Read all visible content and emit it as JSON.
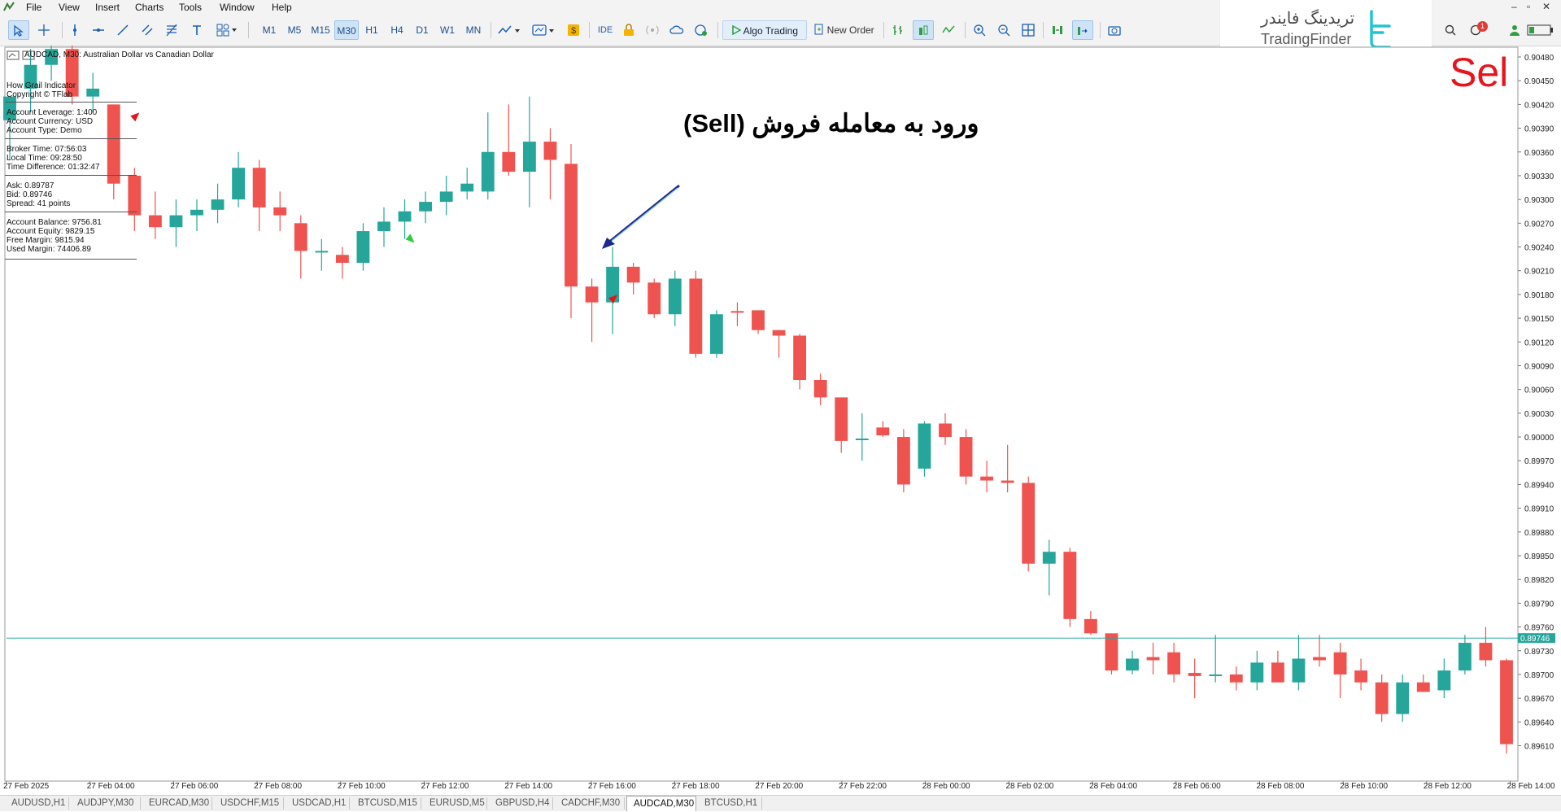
{
  "menu": [
    "File",
    "View",
    "Insert",
    "Charts",
    "Tools",
    "Window",
    "Help"
  ],
  "window_controls": [
    "–",
    "▫",
    "✕"
  ],
  "toolbar": {
    "timeframes": [
      "M1",
      "M5",
      "M15",
      "M30",
      "H1",
      "H4",
      "D1",
      "W1",
      "MN"
    ],
    "active_timeframe": "M30",
    "ide_label": "IDE",
    "algo_label": "Algo Trading",
    "new_order_label": "New Order",
    "notification_count": "1"
  },
  "watermark": {
    "fa": "تریدینگ فایندر",
    "en": "TradingFinder"
  },
  "chart_title": "AUDCAD, M30:  Australian Dollar vs Canadian Dollar",
  "info_panel": {
    "header": [
      "How Grail Indicator",
      "Copyright © TFlab"
    ],
    "account": [
      "Account Leverage: 1:400",
      "Account Currency: USD",
      "Account Type: Demo"
    ],
    "time": [
      "Broker Time: 07:56:03",
      "Local Time: 09:28:50",
      "Time Difference: 01:32:47"
    ],
    "prices": [
      "Ask: 0.89787",
      "Bid: 0.89746",
      "Spread: 41 points"
    ],
    "balance": [
      "Account Balance: 9756.81",
      "Account Equity: 9829.15",
      "Free Margin: 9815.94",
      "Used Margin: 74406.89"
    ]
  },
  "annotation": "ورود به معامله فروش (Sell)",
  "sell_label": "Sel",
  "colors": {
    "bull": "#26a69a",
    "bear": "#ef5350",
    "bid_line": "#26a69a",
    "arrow": "#1e2a8a"
  },
  "chart_data": {
    "type": "candlestick",
    "symbol": "AUDCAD",
    "timeframe": "M30",
    "ylim": [
      0.8959,
      0.9048
    ],
    "y_ticks": [
      "0.90480",
      "0.90450",
      "0.90420",
      "0.90390",
      "0.90360",
      "0.90330",
      "0.90300",
      "0.90270",
      "0.90240",
      "0.90210",
      "0.90180",
      "0.90150",
      "0.90120",
      "0.90090",
      "0.90060",
      "0.90030",
      "0.90000",
      "0.89970",
      "0.89940",
      "0.89910",
      "0.89880",
      "0.89850",
      "0.89820",
      "0.89790",
      "0.89760",
      "0.89730",
      "0.89700",
      "0.89670",
      "0.89640",
      "0.89610"
    ],
    "x_ticks": [
      "27 Feb 2025",
      "27 Feb 04:00",
      "27 Feb 06:00",
      "27 Feb 08:00",
      "27 Feb 10:00",
      "27 Feb 12:00",
      "27 Feb 14:00",
      "27 Feb 16:00",
      "27 Feb 18:00",
      "27 Feb 20:00",
      "27 Feb 22:00",
      "28 Feb 00:00",
      "28 Feb 02:00",
      "28 Feb 04:00",
      "28 Feb 06:00",
      "28 Feb 08:00",
      "28 Feb 10:00",
      "28 Feb 12:00",
      "28 Feb 14:00"
    ],
    "bid": 0.89746,
    "bid_label": "0.89746",
    "candles": [
      {
        "o": 0.904,
        "h": 0.9042,
        "l": 0.9035,
        "c": 0.9043
      },
      {
        "o": 0.9044,
        "h": 0.9049,
        "l": 0.9041,
        "c": 0.9047
      },
      {
        "o": 0.9047,
        "h": 0.9051,
        "l": 0.9045,
        "c": 0.9049
      },
      {
        "o": 0.9049,
        "h": 0.9051,
        "l": 0.9042,
        "c": 0.9043
      },
      {
        "o": 0.9043,
        "h": 0.9046,
        "l": 0.9041,
        "c": 0.9044
      },
      {
        "o": 0.9042,
        "h": 0.9042,
        "l": 0.903,
        "c": 0.9032
      },
      {
        "o": 0.9033,
        "h": 0.9034,
        "l": 0.9026,
        "c": 0.9028
      },
      {
        "o": 0.9028,
        "h": 0.9031,
        "l": 0.9025,
        "c": 0.90265
      },
      {
        "o": 0.90265,
        "h": 0.903,
        "l": 0.9024,
        "c": 0.9028
      },
      {
        "o": 0.9028,
        "h": 0.903,
        "l": 0.9026,
        "c": 0.90287
      },
      {
        "o": 0.90287,
        "h": 0.9032,
        "l": 0.9027,
        "c": 0.903
      },
      {
        "o": 0.903,
        "h": 0.9036,
        "l": 0.9029,
        "c": 0.9034
      },
      {
        "o": 0.9034,
        "h": 0.9035,
        "l": 0.9026,
        "c": 0.9029
      },
      {
        "o": 0.9029,
        "h": 0.9031,
        "l": 0.9026,
        "c": 0.9028
      },
      {
        "o": 0.9027,
        "h": 0.9028,
        "l": 0.902,
        "c": 0.90235
      },
      {
        "o": 0.90235,
        "h": 0.9025,
        "l": 0.9021,
        "c": 0.90235
      },
      {
        "o": 0.9023,
        "h": 0.9024,
        "l": 0.902,
        "c": 0.9022
      },
      {
        "o": 0.9022,
        "h": 0.9027,
        "l": 0.9021,
        "c": 0.9026
      },
      {
        "o": 0.9026,
        "h": 0.9029,
        "l": 0.9024,
        "c": 0.90272
      },
      {
        "o": 0.90272,
        "h": 0.903,
        "l": 0.9025,
        "c": 0.90285
      },
      {
        "o": 0.90285,
        "h": 0.9031,
        "l": 0.9027,
        "c": 0.90297
      },
      {
        "o": 0.90297,
        "h": 0.9033,
        "l": 0.9028,
        "c": 0.9031
      },
      {
        "o": 0.9031,
        "h": 0.9034,
        "l": 0.903,
        "c": 0.9032
      },
      {
        "o": 0.9031,
        "h": 0.9041,
        "l": 0.903,
        "c": 0.9036
      },
      {
        "o": 0.9036,
        "h": 0.9042,
        "l": 0.9033,
        "c": 0.90335
      },
      {
        "o": 0.90335,
        "h": 0.9043,
        "l": 0.9029,
        "c": 0.90373
      },
      {
        "o": 0.90373,
        "h": 0.9039,
        "l": 0.903,
        "c": 0.9035
      },
      {
        "o": 0.90345,
        "h": 0.9037,
        "l": 0.9015,
        "c": 0.9019
      },
      {
        "o": 0.9019,
        "h": 0.902,
        "l": 0.9012,
        "c": 0.9017
      },
      {
        "o": 0.9017,
        "h": 0.9024,
        "l": 0.9013,
        "c": 0.90215
      },
      {
        "o": 0.90215,
        "h": 0.9022,
        "l": 0.9018,
        "c": 0.90195
      },
      {
        "o": 0.90195,
        "h": 0.902,
        "l": 0.9015,
        "c": 0.90155
      },
      {
        "o": 0.90155,
        "h": 0.9021,
        "l": 0.9014,
        "c": 0.902
      },
      {
        "o": 0.902,
        "h": 0.9021,
        "l": 0.901,
        "c": 0.90105
      },
      {
        "o": 0.90105,
        "h": 0.9016,
        "l": 0.901,
        "c": 0.90155
      },
      {
        "o": 0.90159,
        "h": 0.9017,
        "l": 0.9014,
        "c": 0.90157
      },
      {
        "o": 0.9016,
        "h": 0.9016,
        "l": 0.9013,
        "c": 0.90135
      },
      {
        "o": 0.90135,
        "h": 0.9013,
        "l": 0.901,
        "c": 0.90128
      },
      {
        "o": 0.90128,
        "h": 0.9013,
        "l": 0.9006,
        "c": 0.90072
      },
      {
        "o": 0.90072,
        "h": 0.9008,
        "l": 0.9004,
        "c": 0.9005
      },
      {
        "o": 0.9005,
        "h": 0.9005,
        "l": 0.8998,
        "c": 0.89995
      },
      {
        "o": 0.89998,
        "h": 0.9003,
        "l": 0.8997,
        "c": 0.89998
      },
      {
        "o": 0.90012,
        "h": 0.9002,
        "l": 0.9,
        "c": 0.90002
      },
      {
        "o": 0.9,
        "h": 0.9001,
        "l": 0.8993,
        "c": 0.8994
      },
      {
        "o": 0.8996,
        "h": 0.9002,
        "l": 0.8995,
        "c": 0.90017
      },
      {
        "o": 0.90017,
        "h": 0.9003,
        "l": 0.8999,
        "c": 0.9
      },
      {
        "o": 0.9,
        "h": 0.9001,
        "l": 0.8994,
        "c": 0.8995
      },
      {
        "o": 0.8995,
        "h": 0.8997,
        "l": 0.8993,
        "c": 0.89945
      },
      {
        "o": 0.89945,
        "h": 0.8999,
        "l": 0.8993,
        "c": 0.89942
      },
      {
        "o": 0.89942,
        "h": 0.8995,
        "l": 0.8983,
        "c": 0.8984
      },
      {
        "o": 0.8984,
        "h": 0.8987,
        "l": 0.898,
        "c": 0.89855
      },
      {
        "o": 0.89855,
        "h": 0.8986,
        "l": 0.8976,
        "c": 0.8977
      },
      {
        "o": 0.8977,
        "h": 0.8978,
        "l": 0.8975,
        "c": 0.89752
      },
      {
        "o": 0.89752,
        "h": 0.8975,
        "l": 0.897,
        "c": 0.89705
      },
      {
        "o": 0.89705,
        "h": 0.8973,
        "l": 0.897,
        "c": 0.8972
      },
      {
        "o": 0.89722,
        "h": 0.8974,
        "l": 0.897,
        "c": 0.89718
      },
      {
        "o": 0.89728,
        "h": 0.8974,
        "l": 0.8969,
        "c": 0.897
      },
      {
        "o": 0.89702,
        "h": 0.8972,
        "l": 0.8967,
        "c": 0.89698
      },
      {
        "o": 0.897,
        "h": 0.8975,
        "l": 0.8969,
        "c": 0.897
      },
      {
        "o": 0.897,
        "h": 0.8971,
        "l": 0.8968,
        "c": 0.8969
      },
      {
        "o": 0.8969,
        "h": 0.8973,
        "l": 0.8968,
        "c": 0.89715
      },
      {
        "o": 0.89715,
        "h": 0.8973,
        "l": 0.8969,
        "c": 0.8969
      },
      {
        "o": 0.8969,
        "h": 0.8975,
        "l": 0.8968,
        "c": 0.8972
      },
      {
        "o": 0.89722,
        "h": 0.8975,
        "l": 0.8971,
        "c": 0.89718
      },
      {
        "o": 0.89728,
        "h": 0.8974,
        "l": 0.8967,
        "c": 0.897
      },
      {
        "o": 0.89705,
        "h": 0.8972,
        "l": 0.8968,
        "c": 0.8969
      },
      {
        "o": 0.8969,
        "h": 0.897,
        "l": 0.8964,
        "c": 0.8965
      },
      {
        "o": 0.8965,
        "h": 0.897,
        "l": 0.8964,
        "c": 0.8969
      },
      {
        "o": 0.8969,
        "h": 0.897,
        "l": 0.8968,
        "c": 0.89678
      },
      {
        "o": 0.8968,
        "h": 0.8972,
        "l": 0.8967,
        "c": 0.89705
      },
      {
        "o": 0.89705,
        "h": 0.8975,
        "l": 0.897,
        "c": 0.8974
      },
      {
        "o": 0.8974,
        "h": 0.8976,
        "l": 0.8971,
        "c": 0.89718
      },
      {
        "o": 0.89718,
        "h": 0.8972,
        "l": 0.896,
        "c": 0.89612
      }
    ],
    "sell_signal_indices": [
      5,
      28
    ],
    "buy_signal_indices": [
      19
    ]
  },
  "tabs": [
    "AUDUSD,H1",
    "AUDJPY,M30",
    "EURCAD,M30",
    "USDCHF,M15",
    "USDCAD,H1",
    "BTCUSD,M15",
    "EURUSD,M5",
    "GBPUSD,H4",
    "CADCHF,M30",
    "AUDCAD,M30",
    "BTCUSD,H1"
  ],
  "active_tab": "AUDCAD,M30"
}
